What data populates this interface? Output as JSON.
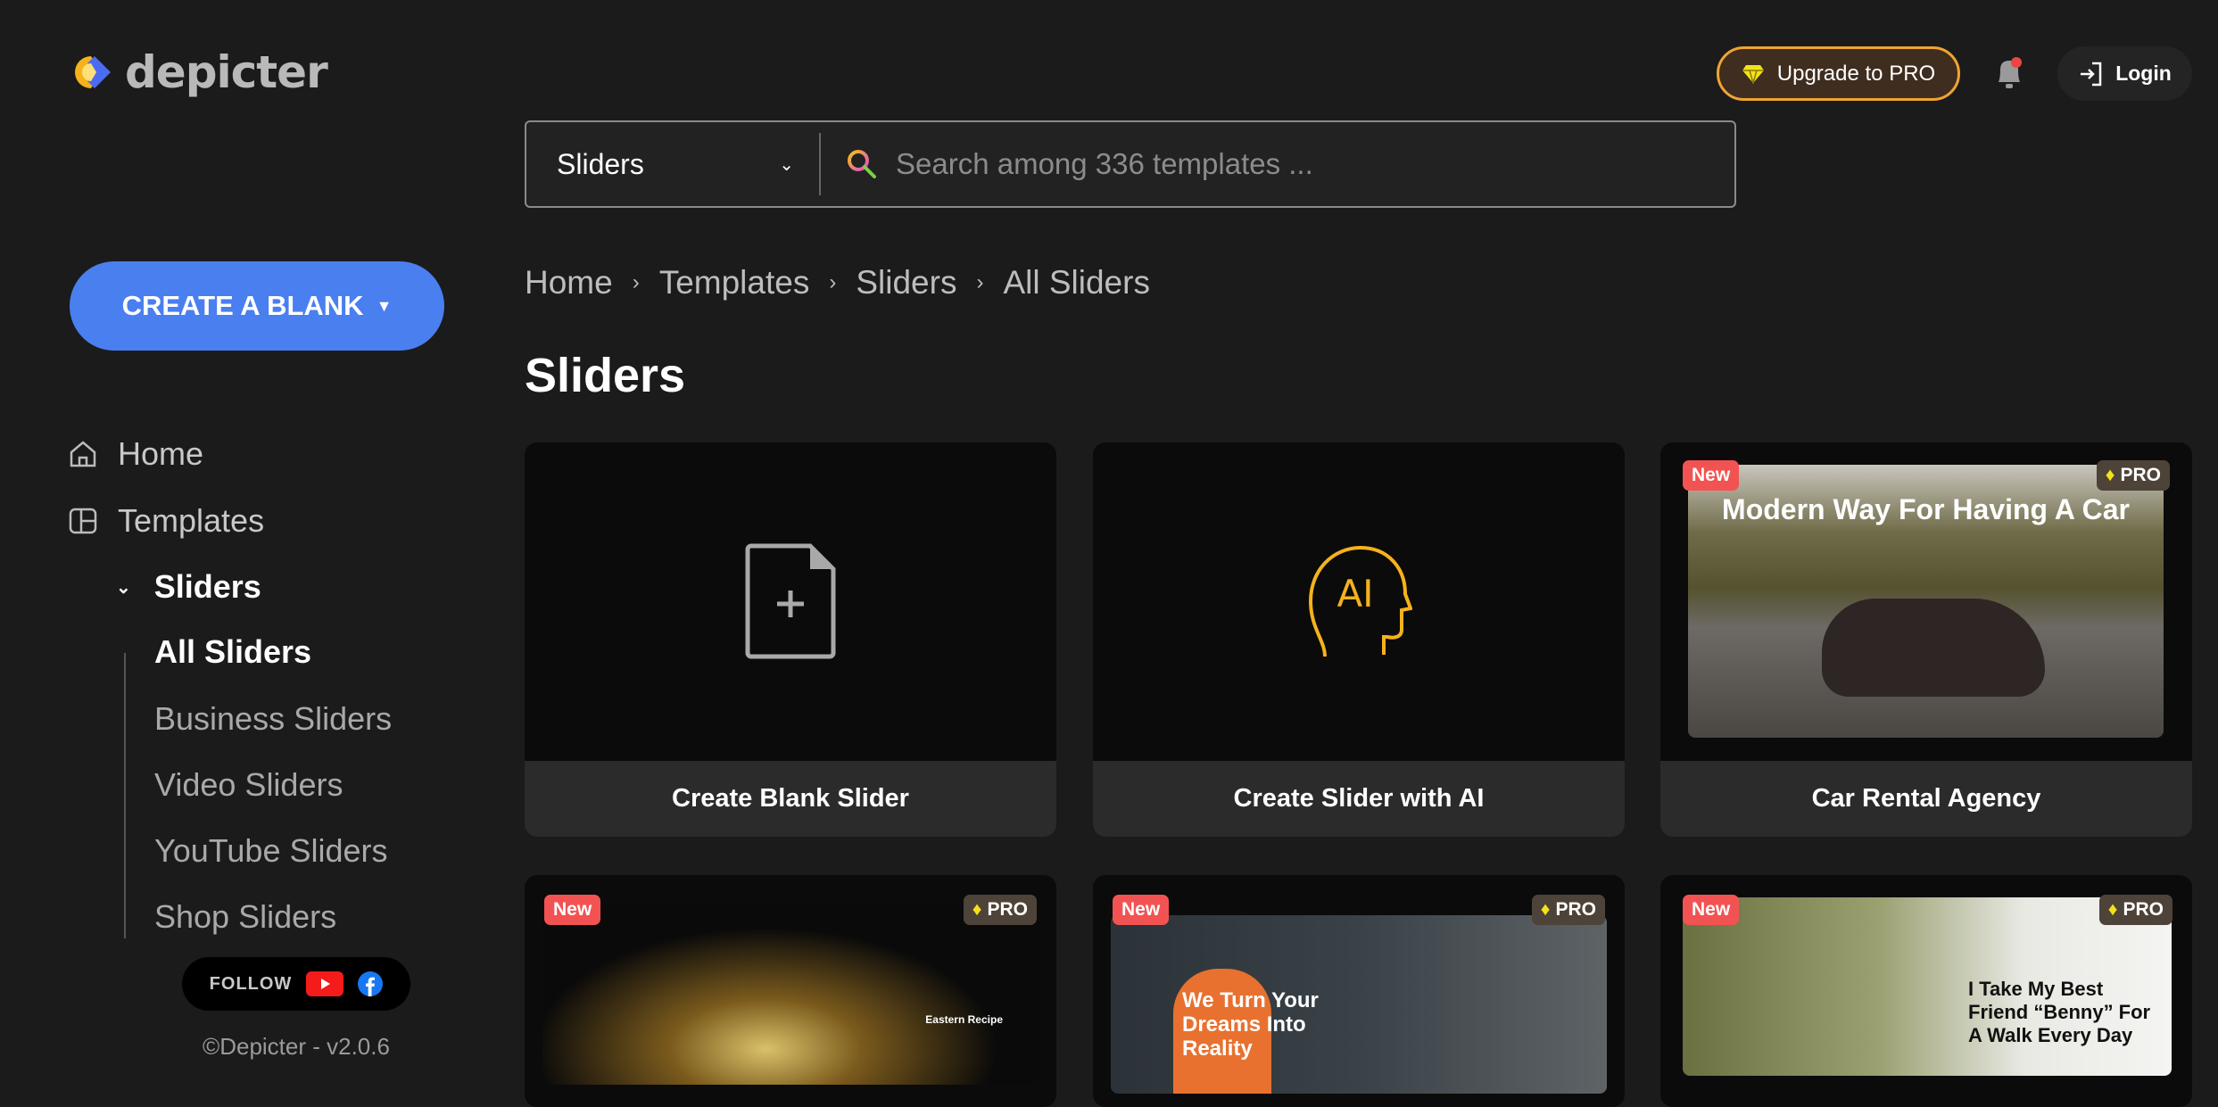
{
  "brand": {
    "name": "depicter"
  },
  "header": {
    "upgrade_label": "Upgrade to PRO",
    "login_label": "Login",
    "has_notification": true
  },
  "search": {
    "category": "Sliders",
    "placeholder": "Search among 336 templates ..."
  },
  "sidebar": {
    "create_label": "CREATE A BLANK",
    "items": [
      {
        "label": "Home",
        "icon": "home-icon"
      },
      {
        "label": "Templates",
        "icon": "templates-icon"
      }
    ],
    "section": "Sliders",
    "subitems": [
      "All Sliders",
      "Business Sliders",
      "Video Sliders",
      "YouTube Sliders",
      "Shop Sliders"
    ],
    "active_subitem": "All Sliders",
    "follow_label": "FOLLOW",
    "copyright": "©Depicter - v2.0.6"
  },
  "breadcrumb": [
    "Home",
    "Templates",
    "Sliders",
    "All Sliders"
  ],
  "page_title": "Sliders",
  "badges": {
    "new": "New",
    "pro": "PRO"
  },
  "cards": [
    {
      "title": "Create Blank Slider"
    },
    {
      "title": "Create Slider with AI",
      "icon_text": "AI"
    },
    {
      "title": "Car Rental Agency",
      "preview_text": "Modern Way For Having A Car"
    },
    {
      "preview_text": "Eastern Recipe"
    },
    {
      "preview_text": "We Turn Your Dreams Into Reality"
    },
    {
      "preview_text": "I Take My Best Friend “Benny” For A Walk Every Day"
    }
  ],
  "colors": {
    "accent": "#4a7ff0",
    "upgrade_border": "#f0a431",
    "new_badge": "#f25352",
    "ai_icon": "#f5b21b"
  }
}
